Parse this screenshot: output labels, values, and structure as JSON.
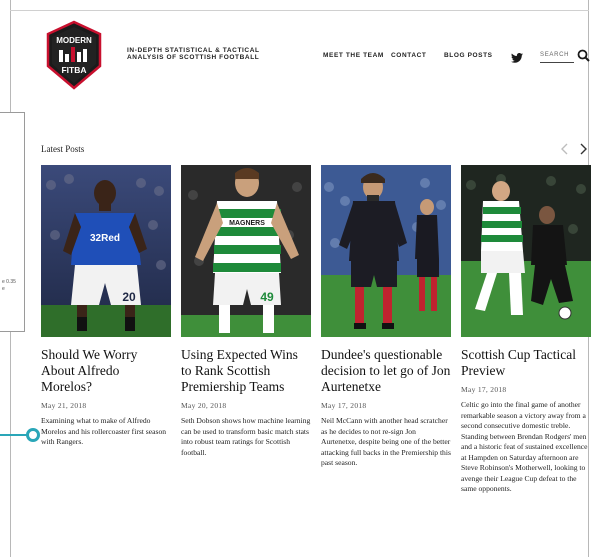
{
  "header": {
    "logo_text_top": "MODERN",
    "logo_text_bottom": "FITBA",
    "tagline_line1": "IN-DEPTH STATISTICAL & TACTICAL",
    "tagline_line2": "ANALYSIS OF SCOTTISH FOOTBALL",
    "nav": [
      "MEET THE TEAM",
      "CONTACT",
      "BLOG POSTS"
    ],
    "search_label": "SEARCH"
  },
  "side_card": {
    "mini_line1": "e 0.35",
    "mini_line2": "e"
  },
  "section": {
    "title": "Latest Posts"
  },
  "posts": [
    {
      "title": "Should We Worry About Alfredo Morelos?",
      "date": "May 21, 2018",
      "excerpt": "Examining what to make of Alfredo Morelos and his rollercoaster first season with Rangers."
    },
    {
      "title": "Using Expected Wins to Rank Scottish Premiership Teams",
      "date": "May 20, 2018",
      "excerpt": "Seth Dobson shows how machine learning can be used to transform basic match stats into robust team ratings for Scottish football."
    },
    {
      "title": "Dundee's questionable decision to let go of Jon Aurtenetxe",
      "date": "May 17, 2018",
      "excerpt": "Neil McCann with another head scratcher as he decides to not re-sign Jon Aurtenetxe, despite being one of the better attacking full backs in the Premiership this past season."
    },
    {
      "title": "Scottish Cup Tactical Preview",
      "date": "May 17, 2018",
      "excerpt": "Celtic go into the final game of another remarkable season a victory away from a second consecutive domestic treble. Standing between Brendan Rodgers' men and a historic feat of sustained excellence at Hampden on Saturday afternoon are Steve Robinson's Motherwell, looking to avenge their League Cup defeat to the same opponents."
    }
  ],
  "thumbs": [
    {
      "shirt_text": "32Red",
      "number": "20"
    },
    {
      "shirt_text": "MAGNERS",
      "number": "49"
    },
    {
      "shirt_text": "",
      "number": ""
    },
    {
      "shirt_text": "",
      "number": ""
    }
  ],
  "colors": {
    "accent": "#2aa6b8",
    "rangers_blue": "#1f4fb8",
    "celtic_green": "#1e8a3a",
    "pitch_green": "#3f8f3a",
    "logo_red": "#c8102e"
  },
  "icons": {
    "twitter": "twitter-icon",
    "search": "search-icon",
    "prev": "chevron-left-icon",
    "next": "chevron-right-icon"
  }
}
